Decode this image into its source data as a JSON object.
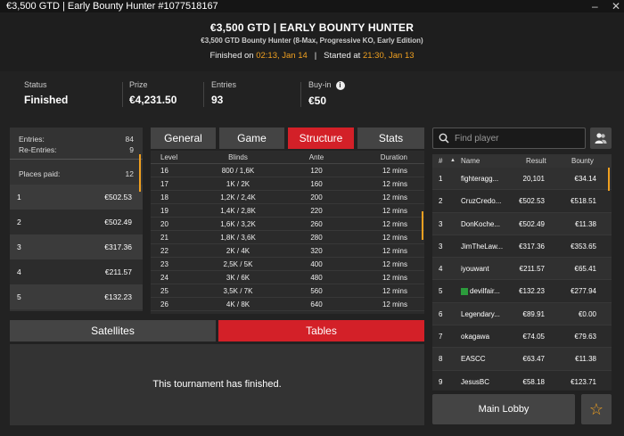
{
  "window": {
    "title": "€3,500 GTD | Early Bounty Hunter #1077518167",
    "minimize": "–",
    "close": "✕"
  },
  "header": {
    "title": "€3,500 GTD | EARLY BOUNTY HUNTER",
    "subtitle": "€3,500 GTD Bounty Hunter (8-Max, Progressive KO, Early Edition)",
    "finished_label": "Finished on",
    "finished_time": "02:13, Jan 14",
    "separator": "|",
    "started_label": "Started at",
    "started_time": "21:30, Jan 13"
  },
  "summary": {
    "status_label": "Status",
    "status_value": "Finished",
    "prize_label": "Prize",
    "prize_value": "€4,231.50",
    "entries_label": "Entries",
    "entries_value": "93",
    "buyin_label": "Buy-in",
    "buyin_value": "€50"
  },
  "left_panel": {
    "entries_label": "Entries:",
    "entries_value": "84",
    "reentries_label": "Re-Entries:",
    "reentries_value": "9",
    "places_paid_label": "Places paid:",
    "places_paid_value": "12",
    "places": [
      {
        "place": "1",
        "prize": "€502.53"
      },
      {
        "place": "2",
        "prize": "€502.49"
      },
      {
        "place": "3",
        "prize": "€317.36"
      },
      {
        "place": "4",
        "prize": "€211.57"
      },
      {
        "place": "5",
        "prize": "€132.23"
      }
    ]
  },
  "tabs": {
    "general": "General",
    "game": "Game",
    "structure": "Structure",
    "stats": "Stats"
  },
  "structure": {
    "headers": {
      "level": "Level",
      "blinds": "Blinds",
      "ante": "Ante",
      "duration": "Duration"
    },
    "rows": [
      [
        "16",
        "800 / 1,6K",
        "120",
        "12 mins"
      ],
      [
        "17",
        "1K / 2K",
        "160",
        "12 mins"
      ],
      [
        "18",
        "1,2K / 2,4K",
        "200",
        "12 mins"
      ],
      [
        "19",
        "1,4K / 2,8K",
        "220",
        "12 mins"
      ],
      [
        "20",
        "1,6K / 3,2K",
        "260",
        "12 mins"
      ],
      [
        "21",
        "1,8K / 3,6K",
        "280",
        "12 mins"
      ],
      [
        "22",
        "2K / 4K",
        "320",
        "12 mins"
      ],
      [
        "23",
        "2,5K / 5K",
        "400",
        "12 mins"
      ],
      [
        "24",
        "3K / 6K",
        "480",
        "12 mins"
      ],
      [
        "25",
        "3,5K / 7K",
        "560",
        "12 mins"
      ],
      [
        "26",
        "4K / 8K",
        "640",
        "12 mins"
      ]
    ]
  },
  "bottom_tabs": {
    "satellites": "Satellites",
    "tables": "Tables"
  },
  "finished_message": "This tournament has finished.",
  "search": {
    "placeholder": "Find player"
  },
  "players": {
    "headers": {
      "num": "#",
      "name": "Name",
      "result": "Result",
      "bounty": "Bounty"
    },
    "rows": [
      {
        "n": "1",
        "name": "fighteragg...",
        "result": "20,101",
        "bounty": "€34.14",
        "flag": false
      },
      {
        "n": "2",
        "name": "CruzCredo...",
        "result": "€502.53",
        "bounty": "€518.51",
        "flag": false
      },
      {
        "n": "3",
        "name": "DonKoche...",
        "result": "€502.49",
        "bounty": "€11.38",
        "flag": false
      },
      {
        "n": "3",
        "name": "JimTheLaw...",
        "result": "€317.36",
        "bounty": "€353.65",
        "flag": false
      },
      {
        "n": "4",
        "name": "iyouwant",
        "result": "€211.57",
        "bounty": "€65.41",
        "flag": false
      },
      {
        "n": "5",
        "name": "devilfair...",
        "result": "€132.23",
        "bounty": "€277.94",
        "flag": true
      },
      {
        "n": "6",
        "name": "Legendary...",
        "result": "€89.91",
        "bounty": "€0.00",
        "flag": false
      },
      {
        "n": "7",
        "name": "okagawa",
        "result": "€74.05",
        "bounty": "€79.63",
        "flag": false
      },
      {
        "n": "8",
        "name": "EASCC",
        "result": "€63.47",
        "bounty": "€11.38",
        "flag": false
      },
      {
        "n": "9",
        "name": "JesusBC",
        "result": "€58.18",
        "bounty": "€123.71",
        "flag": false
      }
    ]
  },
  "main_lobby": "Main Lobby",
  "colors": {
    "accent": "#d32028",
    "highlight": "#f0a020"
  }
}
